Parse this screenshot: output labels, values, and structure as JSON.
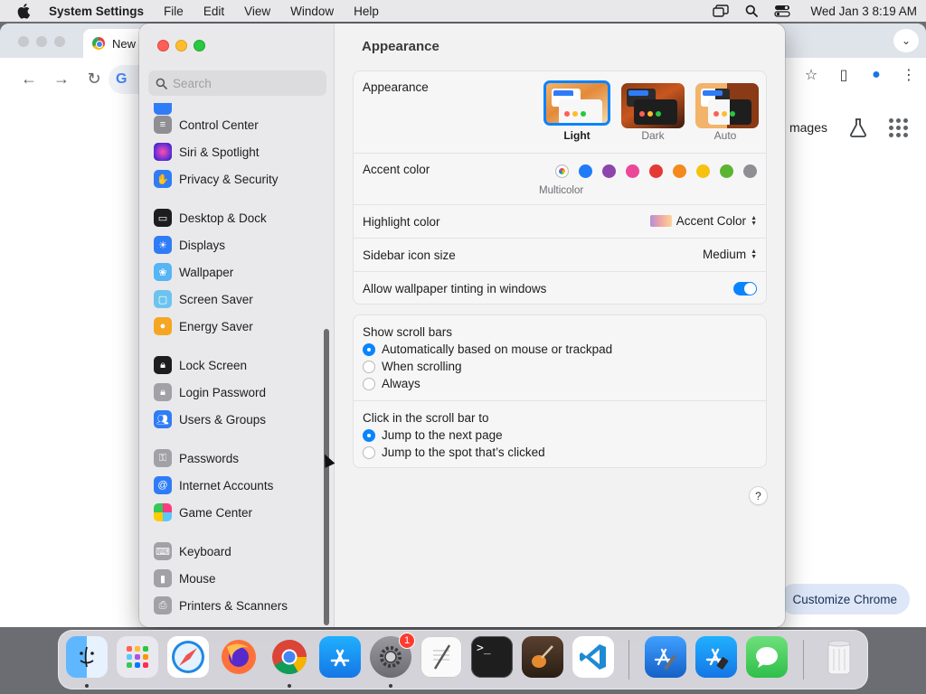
{
  "menubar": {
    "app_name": "System Settings",
    "items": [
      "File",
      "Edit",
      "View",
      "Window",
      "Help"
    ],
    "clock": "Wed Jan 3  8:19 AM"
  },
  "chrome": {
    "tab_title": "New",
    "toolbar_logo": "G",
    "gbar_images": "mages",
    "customize_label": "Customize Chrome"
  },
  "settings": {
    "search_placeholder": "Search",
    "sidebar": {
      "items": [
        {
          "label": "Control Center",
          "icon": "control-center-icon",
          "color": "#8e8e93"
        },
        {
          "label": "Siri & Spotlight",
          "icon": "siri-icon",
          "color": "#7a3cff"
        },
        {
          "label": "Privacy & Security",
          "icon": "hand-icon",
          "color": "#2f7cf6"
        },
        {
          "label": "Desktop & Dock",
          "icon": "dock-icon",
          "color": "#1d1d1f"
        },
        {
          "label": "Displays",
          "icon": "sun-icon",
          "color": "#2f7cf6"
        },
        {
          "label": "Wallpaper",
          "icon": "flower-icon",
          "color": "#3aa0f0"
        },
        {
          "label": "Screen Saver",
          "icon": "screen-saver-icon",
          "color": "#4ab3e8"
        },
        {
          "label": "Energy Saver",
          "icon": "bulb-icon",
          "color": "#f5a623"
        },
        {
          "label": "Lock Screen",
          "icon": "lock-icon",
          "color": "#1d1d1f"
        },
        {
          "label": "Login Password",
          "icon": "lock-icon",
          "color": "#8e8e93"
        },
        {
          "label": "Users & Groups",
          "icon": "users-icon",
          "color": "#2f7cf6"
        },
        {
          "label": "Passwords",
          "icon": "key-icon",
          "color": "#8e8e93"
        },
        {
          "label": "Internet Accounts",
          "icon": "at-icon",
          "color": "#2f7cf6"
        },
        {
          "label": "Game Center",
          "icon": "game-center-icon",
          "color": "#e9e9eb"
        },
        {
          "label": "Keyboard",
          "icon": "keyboard-icon",
          "color": "#8e8e93"
        },
        {
          "label": "Mouse",
          "icon": "mouse-icon",
          "color": "#8e8e93"
        },
        {
          "label": "Printers & Scanners",
          "icon": "printer-icon",
          "color": "#8e8e93"
        }
      ]
    },
    "main": {
      "title": "Appearance",
      "appearance_label": "Appearance",
      "themes": [
        {
          "label": "Light",
          "selected": true
        },
        {
          "label": "Dark",
          "selected": false
        },
        {
          "label": "Auto",
          "selected": false
        }
      ],
      "accent_label": "Accent color",
      "accent_caption": "Multicolor",
      "accent_colors": [
        "multicolor",
        "#1f7cf6",
        "#8e44ad",
        "#ec4899",
        "#e53935",
        "#f4891e",
        "#f6c20f",
        "#5cb531",
        "#8e8e93"
      ],
      "highlight_label": "Highlight color",
      "highlight_value": "Accent Color",
      "sidebar_icon_label": "Sidebar icon size",
      "sidebar_icon_value": "Medium",
      "tinting_label": "Allow wallpaper tinting in windows",
      "tinting_on": true,
      "scroll_bars_label": "Show scroll bars",
      "scroll_bars_options": [
        {
          "label": "Automatically based on mouse or trackpad",
          "selected": true
        },
        {
          "label": "When scrolling",
          "selected": false
        },
        {
          "label": "Always",
          "selected": false
        }
      ],
      "click_scroll_label": "Click in the scroll bar to",
      "click_scroll_options": [
        {
          "label": "Jump to the next page",
          "selected": true
        },
        {
          "label": "Jump to the spot that’s clicked",
          "selected": false
        }
      ],
      "help": "?"
    }
  },
  "dock": {
    "apps": [
      {
        "name": "Finder",
        "icon": "finder-icon",
        "color": "#2e8bf0",
        "running": true
      },
      {
        "name": "Launchpad",
        "icon": "launchpad-icon",
        "color": "#e8e8ee",
        "running": false
      },
      {
        "name": "Safari",
        "icon": "safari-icon",
        "color": "#1e88e5",
        "running": false
      },
      {
        "name": "Firefox",
        "icon": "firefox-icon",
        "color": "#ff7139",
        "running": false
      },
      {
        "name": "Chrome",
        "icon": "chrome-icon",
        "color": "#ffffff",
        "running": true
      },
      {
        "name": "App Store",
        "icon": "app-store-icon",
        "color": "#1b8cf2",
        "running": false
      },
      {
        "name": "System Settings",
        "icon": "gear-icon",
        "color": "#8e8e93",
        "running": true,
        "badge": "1"
      },
      {
        "name": "TextEdit",
        "icon": "textedit-icon",
        "color": "#f4f4f4",
        "running": false
      },
      {
        "name": "Terminal",
        "icon": "terminal-icon",
        "color": "#1e1e1e",
        "running": false
      },
      {
        "name": "GarageBand",
        "icon": "guitar-icon",
        "color": "#3a2a1e",
        "running": false
      },
      {
        "name": "VS Code",
        "icon": "vscode-icon",
        "color": "#ffffff",
        "running": false
      },
      {
        "name": "Xcode",
        "icon": "hammer-icon",
        "color": "#1b6fd8",
        "running": false
      },
      {
        "name": "Simulator",
        "icon": "app-store-icon",
        "color": "#1b8cf2",
        "running": false
      },
      {
        "name": "Messages",
        "icon": "messages-icon",
        "color": "#34c759",
        "running": false
      },
      {
        "name": "Trash",
        "icon": "trash-icon",
        "color": "#e6e6ea",
        "running": false
      }
    ]
  }
}
